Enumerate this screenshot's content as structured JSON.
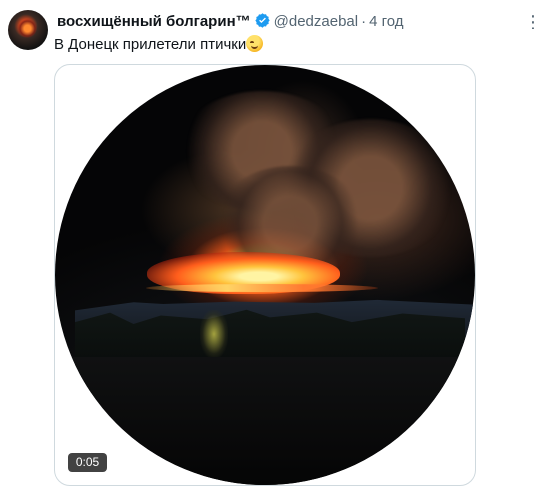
{
  "tweet": {
    "author_name": "восхищённый болгарин™",
    "handle": "@dedzaebal",
    "separator": "·",
    "time": "4 год",
    "text": "В Донецк прилетели птички",
    "emoji_icon": "smiling-face-icon",
    "verified_icon": "verified-badge-icon",
    "more_icon": "more-options-icon"
  },
  "media": {
    "duration": "0:05"
  },
  "colors": {
    "text": "#0f1419",
    "secondary_text": "#536471",
    "verified": "#1d9bf0",
    "border": "#cfd9de",
    "badge": "#000000"
  }
}
